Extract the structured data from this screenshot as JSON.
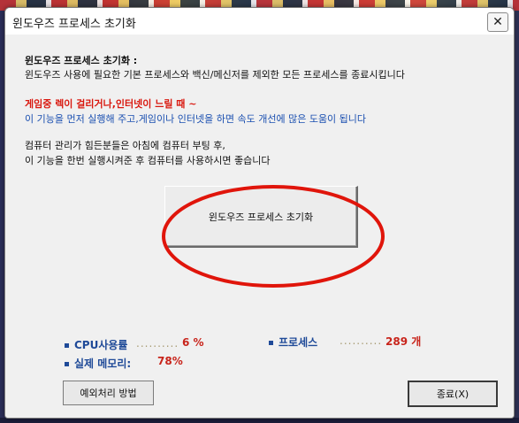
{
  "window": {
    "title": "윈도우즈 프로세스 초기화",
    "close_glyph": "✕"
  },
  "intro": {
    "heading": "윈도우즈 프로세스 초기화 :",
    "line": "윈도우즈 사용에 필요한 기본 프로세스와 백신/메신저를 제외한 모든 프로세스를 종료시킵니다"
  },
  "tip": {
    "warning": "게임중 렉이 걸리거나,인터넷이 느릴 때 ~",
    "advice": "이 기능을 먼저 실행해 주고,게임이나 인터넷을 하면 속도 개선에 많은 도움이 됩니다"
  },
  "note": {
    "line1": "컴퓨터 관리가 힘든분들은 아침에 컴퓨터 부팅 후,",
    "line2": "이 기능을 한번 실행시켜준 후 컴퓨터를 사용하시면 좋습니다"
  },
  "main_button": {
    "label": "윈도우즈 프로세스 초기화"
  },
  "stats": {
    "cpu": {
      "label": "CPU사용률",
      "dots": "..........",
      "value": "6 %"
    },
    "process": {
      "label": "프로세스",
      "dots": "..........",
      "value": "289 개"
    },
    "memory": {
      "label": "실제 메모리:",
      "value": "78%"
    }
  },
  "buttons": {
    "exception": "예외처리 방법",
    "exit": "종료(X)"
  },
  "colors": {
    "accent_red": "#d9180f",
    "accent_blue": "#1a4fb0",
    "annotation_red": "#e0150b"
  }
}
